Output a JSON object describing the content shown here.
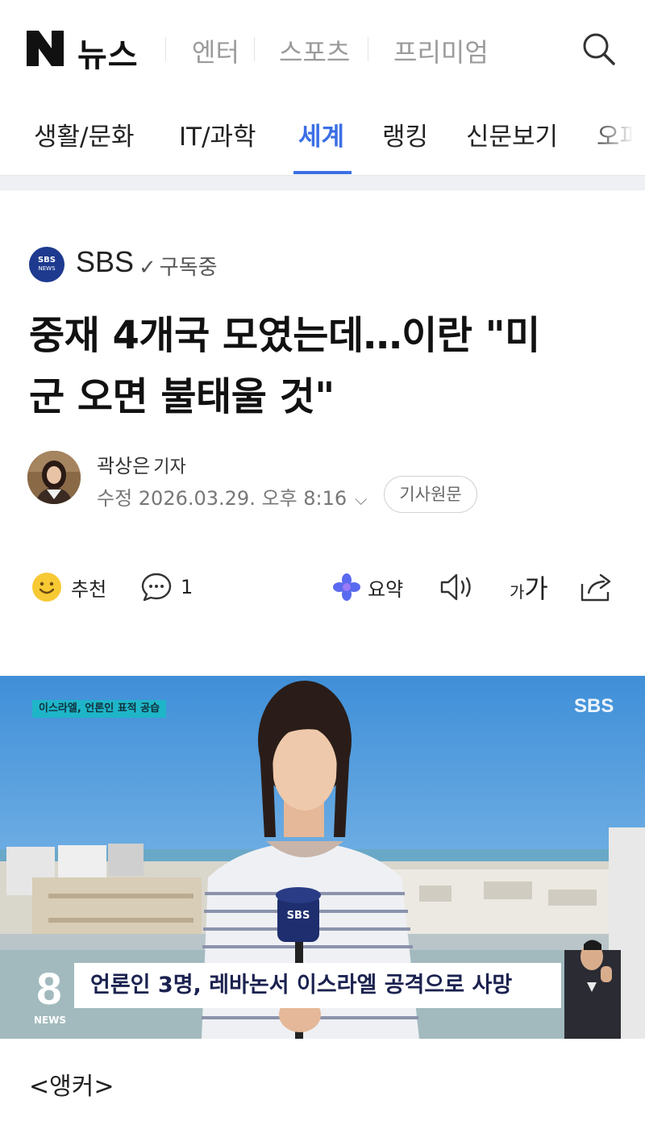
{
  "header": {
    "logo_letter": "N",
    "logo_text": "뉴스",
    "top_nav": [
      "엔터",
      "스포츠",
      "프리미엄"
    ]
  },
  "categories": [
    {
      "label": "생활/문화",
      "active": false
    },
    {
      "label": "IT/과학",
      "active": false
    },
    {
      "label": "세계",
      "active": true
    },
    {
      "label": "랭킹",
      "active": false
    },
    {
      "label": "신문보기",
      "active": false
    },
    {
      "label": "오피",
      "active": false
    }
  ],
  "press": {
    "logo_text": "SBS",
    "logo_sub": "NEWS",
    "name": "SBS",
    "subscribe_status": "구독중"
  },
  "article": {
    "headline_line1": "중재 4개국 모였는데…이란 \"미",
    "headline_line2": "군 오면 불태울 것\"",
    "reporter_name": "곽상은",
    "reporter_role": "기자",
    "edit_time": "수정 2026.03.29. 오후 8:16",
    "original_button": "기사원문"
  },
  "actions": {
    "recommend_label": "추천",
    "comment_count": "1",
    "summary_label": "요약",
    "font_size_label_small": "가",
    "font_size_label_large": "가"
  },
  "video": {
    "top_caption": "이스라엘, 언론인 표적 공습",
    "channel_mark": "SBS",
    "mic_label": "SBS",
    "subtitle": "언론인 3명, 레바논서 이스라엘 공격으로 사망",
    "program_number": "8",
    "program_label": "NEWS"
  },
  "body": {
    "first_line": "<앵커>"
  },
  "colors": {
    "accent": "#3b6fe5",
    "press_logo_bg": "#1d3a8f",
    "caption_bg": "#1fb5c9",
    "ai_icon": "#5a6af0"
  }
}
